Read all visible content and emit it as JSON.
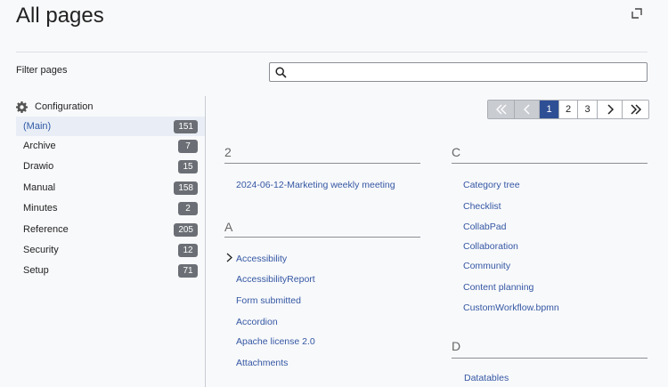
{
  "page": {
    "title": "All pages"
  },
  "filter": {
    "label": "Filter pages",
    "value": "",
    "placeholder": ""
  },
  "sidebar": {
    "heading": "Configuration",
    "items": [
      {
        "label": "(Main)",
        "count": "151",
        "active": true
      },
      {
        "label": "Archive",
        "count": "7"
      },
      {
        "label": "Drawio",
        "count": "15"
      },
      {
        "label": "Manual",
        "count": "158"
      },
      {
        "label": "Minutes",
        "count": "2"
      },
      {
        "label": "Reference",
        "count": "205"
      },
      {
        "label": "Security",
        "count": "12"
      },
      {
        "label": "Setup",
        "count": "71"
      }
    ]
  },
  "pagination": {
    "pages": [
      "1",
      "2",
      "3"
    ],
    "current": "1"
  },
  "sections": {
    "s2": {
      "heading": "2",
      "links": [
        "2024-06-12-Marketing weekly meeting"
      ]
    },
    "sA": {
      "heading": "A",
      "links": [
        "Accessibility",
        "AccessibilityReport",
        "Form submitted",
        "Accordion",
        "Apache license 2.0",
        "Attachments"
      ]
    },
    "sC": {
      "heading": "C",
      "links": [
        "Category tree",
        "Checklist",
        "CollabPad",
        "Collaboration",
        "Community",
        "Content planning",
        "CustomWorkflow.bpmn"
      ]
    },
    "sD": {
      "heading": "D",
      "links": [
        "Datatables"
      ]
    }
  },
  "colors": {
    "accent": "#2f4f95",
    "link": "#3457a3",
    "badge": "#6b6f75",
    "active_row": "#e9eef6"
  }
}
